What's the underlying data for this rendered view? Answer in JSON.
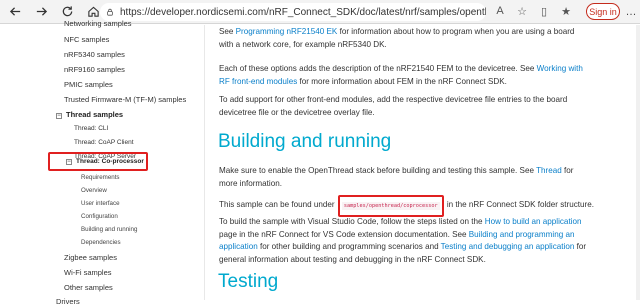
{
  "browser": {
    "url": "https://developer.nordicsemi.com/nRF_Connect_SDK/doc/latest/nrf/samples/openthread/coprocessor/...",
    "signin_label": "Sign in"
  },
  "sidebar": {
    "items": [
      {
        "label": "Networking samples"
      },
      {
        "label": "NFC samples"
      },
      {
        "label": "nRF5340 samples"
      },
      {
        "label": "nRF9160 samples"
      },
      {
        "label": "PMIC samples"
      },
      {
        "label": "Trusted Firmware-M (TF-M) samples"
      },
      {
        "label": "Thread samples"
      },
      {
        "label": "Thread: CLI"
      },
      {
        "label": "Thread: CoAP Client"
      },
      {
        "label": "Thread: CoAP Server"
      },
      {
        "label": "Thread: Co-processor"
      },
      {
        "label": "Requirements"
      },
      {
        "label": "Overview"
      },
      {
        "label": "User interface"
      },
      {
        "label": "Configuration"
      },
      {
        "label": "Building and running"
      },
      {
        "label": "Dependencies"
      },
      {
        "label": "Zigbee samples"
      },
      {
        "label": "Wi-Fi samples"
      },
      {
        "label": "Other samples"
      },
      {
        "label": "Drivers"
      }
    ]
  },
  "main": {
    "p1_pre": "See ",
    "p1_link": "Programming nRF21540 EK",
    "p1_post": " for information about how to program when you are using a board with a network core, for example nRF5340 DK.",
    "p2_pre": "Each of these options adds the description of the nRF21540 FEM to the devicetree. See ",
    "p2_link": "Working with RF front-end modules",
    "p2_post": " for more information about FEM in the nRF Connect SDK.",
    "p3": "To add support for other front-end modules, add the respective devicetree file entries to the board devicetree file or the devicetree overlay file.",
    "heading_build": "Building and running",
    "p4_pre": "Make sure to enable the OpenThread stack before building and testing this sample. See ",
    "p4_link": "Thread",
    "p4_post": " for more information.",
    "p5_pre": "This sample can be found under ",
    "p5_code": "samples/openthread/coprocessor",
    "p5_post": " in the nRF Connect SDK folder structure.",
    "p6_pre": "To build the sample with Visual Studio Code, follow the steps listed on the ",
    "p6_link1": "How to build an application",
    "p6_mid1": " page in the nRF Connect for VS Code extension documentation. See ",
    "p6_link2": "Building and programming an application",
    "p6_mid2": " for other building and programming scenarios and ",
    "p6_link3": "Testing and debugging an application",
    "p6_post": " for general information about testing and debugging in the nRF Connect SDK.",
    "heading_testing": "Testing"
  },
  "colors": {
    "heading": "#00a9ce",
    "link": "#0a7fc9",
    "highlight": "#e02020"
  }
}
